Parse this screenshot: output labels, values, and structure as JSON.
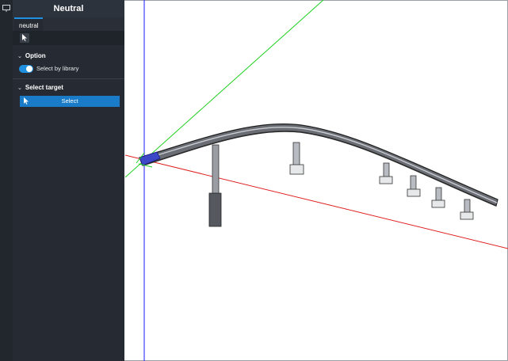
{
  "panel": {
    "title": "Neutral",
    "tab": "neutral",
    "option_header": "Option",
    "toggle_label": "Select by library",
    "toggle_on": true,
    "select_target_header": "Select target",
    "select_button": "Select"
  },
  "icons": {
    "left_strip": "display-icon",
    "tool": "pointer-icon",
    "chevron": "chevron-down-icon"
  },
  "colors": {
    "accent": "#1f8fe0",
    "axis_x": "#e02020",
    "axis_y": "#20d020",
    "axis_z": "#1a1aff"
  }
}
